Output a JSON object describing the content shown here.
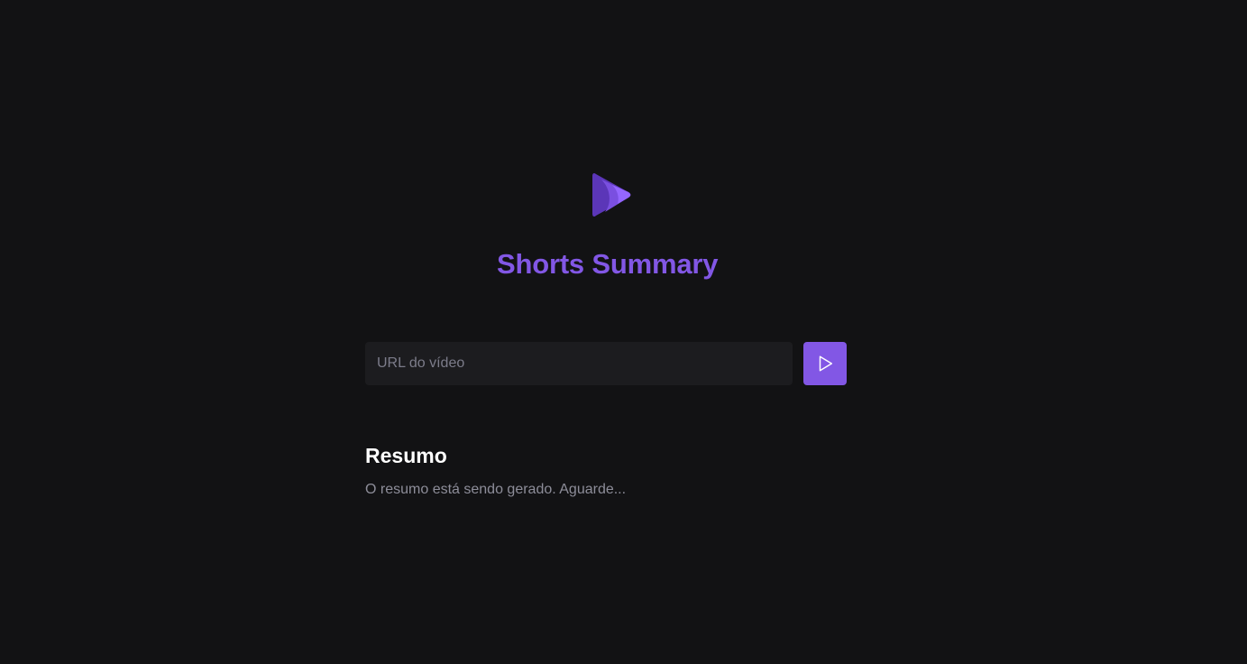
{
  "header": {
    "logo_icon": "play-logo-icon",
    "title": "Shorts Summary"
  },
  "form": {
    "url_placeholder": "URL do vídeo",
    "url_value": "",
    "submit_icon": "play-outline-icon"
  },
  "summary": {
    "title": "Resumo",
    "status_text": "O resumo está sendo gerado. Aguarde..."
  },
  "colors": {
    "background": "#121214",
    "accent": "#8257e5",
    "input_background": "#1c1c1f",
    "muted_text": "#8d8d99",
    "heading_text": "#ffffff"
  }
}
